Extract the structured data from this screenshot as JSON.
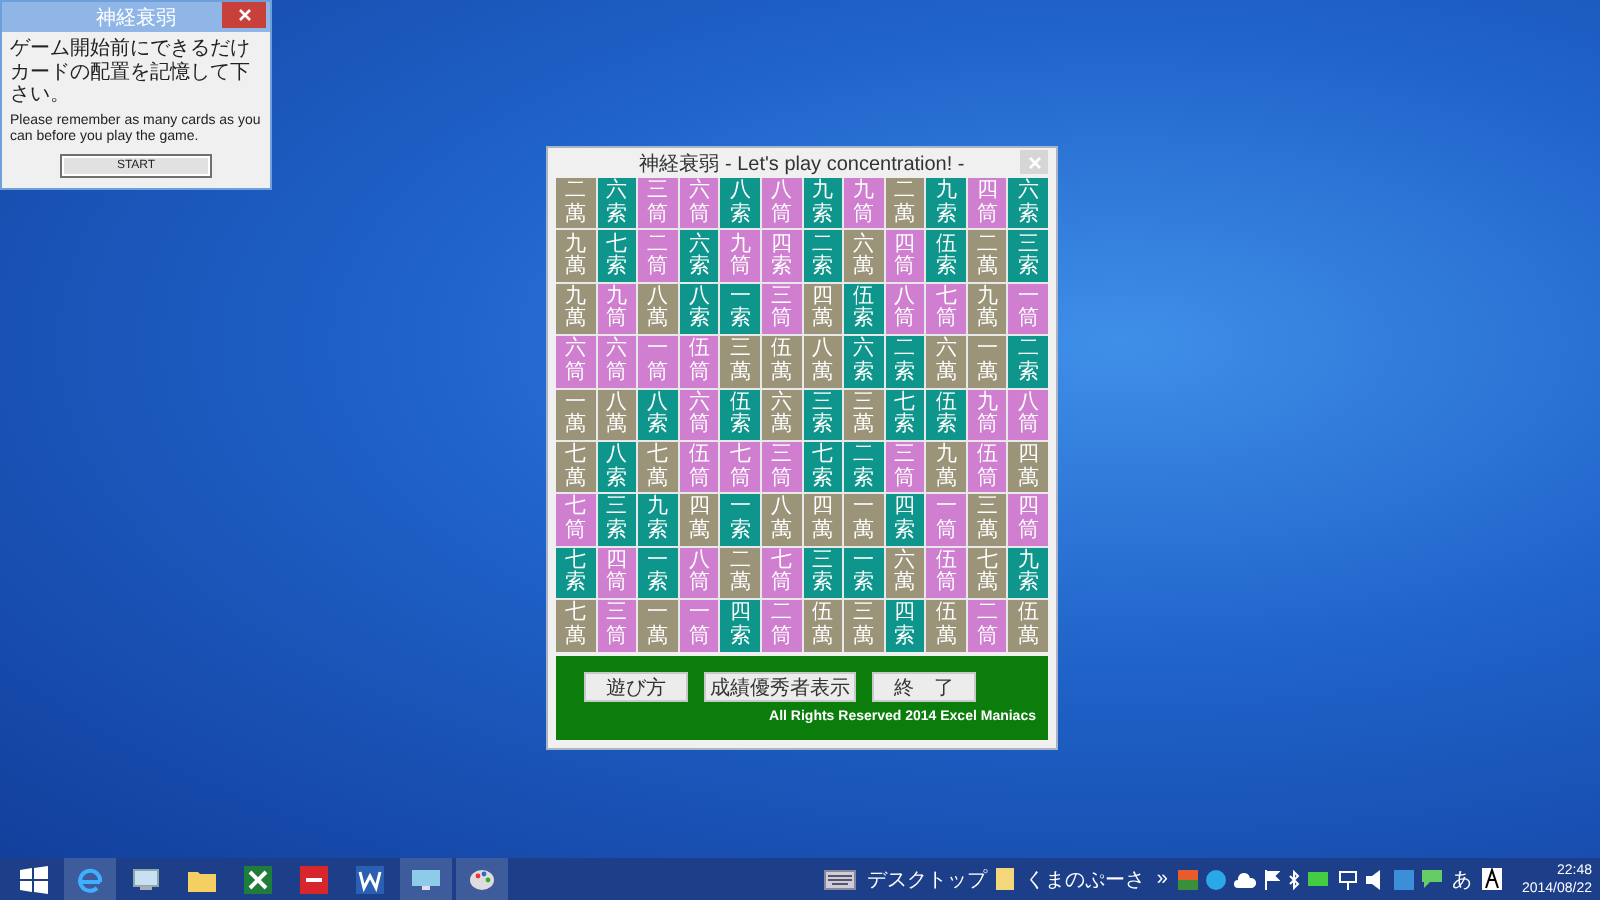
{
  "dialog": {
    "title": "神経衰弱",
    "message_ja": "ゲーム開始前にできるだけカードの配置を記憶して下さい。",
    "message_en": "Please remember as many cards as you can  before you play the game.",
    "button": "START"
  },
  "window": {
    "title": "神経衰弱 - Let's play concentration!  -"
  },
  "board": {
    "rows": [
      [
        {
          "label": "二萬",
          "color": "#9b9478"
        },
        {
          "label": "六索",
          "color": "#0e968c"
        },
        {
          "label": "三筒",
          "color": "#d07fd0"
        },
        {
          "label": "六筒",
          "color": "#d07fd0"
        },
        {
          "label": "八索",
          "color": "#0e968c"
        },
        {
          "label": "八筒",
          "color": "#d07fd0"
        },
        {
          "label": "九索",
          "color": "#0e968c"
        },
        {
          "label": "九筒",
          "color": "#d07fd0"
        },
        {
          "label": "二萬",
          "color": "#9b9478"
        },
        {
          "label": "九索",
          "color": "#0e968c"
        },
        {
          "label": "四筒",
          "color": "#d07fd0"
        },
        {
          "label": "六索",
          "color": "#0e968c"
        }
      ],
      [
        {
          "label": "九萬",
          "color": "#9b9478"
        },
        {
          "label": "七索",
          "color": "#0e968c"
        },
        {
          "label": "二筒",
          "color": "#d07fd0"
        },
        {
          "label": "六索",
          "color": "#0e968c"
        },
        {
          "label": "九筒",
          "color": "#d07fd0"
        },
        {
          "label": "四索",
          "color": "#d07fd0"
        },
        {
          "label": "二索",
          "color": "#0e968c"
        },
        {
          "label": "六萬",
          "color": "#9b9478"
        },
        {
          "label": "四筒",
          "color": "#d07fd0"
        },
        {
          "label": "伍索",
          "color": "#0e968c"
        },
        {
          "label": "二萬",
          "color": "#9b9478"
        },
        {
          "label": "三索",
          "color": "#0e968c"
        }
      ],
      [
        {
          "label": "九萬",
          "color": "#9b9478"
        },
        {
          "label": "九筒",
          "color": "#d07fd0"
        },
        {
          "label": "八萬",
          "color": "#9b9478"
        },
        {
          "label": "八索",
          "color": "#0e968c"
        },
        {
          "label": "一索",
          "color": "#0e968c"
        },
        {
          "label": "三筒",
          "color": "#d07fd0"
        },
        {
          "label": "四萬",
          "color": "#9b9478"
        },
        {
          "label": "伍索",
          "color": "#0e968c"
        },
        {
          "label": "八筒",
          "color": "#d07fd0"
        },
        {
          "label": "七筒",
          "color": "#d07fd0"
        },
        {
          "label": "九萬",
          "color": "#9b9478"
        },
        {
          "label": "一筒",
          "color": "#d07fd0"
        }
      ],
      [
        {
          "label": "六筒",
          "color": "#d07fd0"
        },
        {
          "label": "六筒",
          "color": "#d07fd0"
        },
        {
          "label": "一筒",
          "color": "#d07fd0"
        },
        {
          "label": "伍筒",
          "color": "#d07fd0"
        },
        {
          "label": "三萬",
          "color": "#9b9478"
        },
        {
          "label": "伍萬",
          "color": "#9b9478"
        },
        {
          "label": "八萬",
          "color": "#9b9478"
        },
        {
          "label": "六索",
          "color": "#0e968c"
        },
        {
          "label": "二索",
          "color": "#0e968c"
        },
        {
          "label": "六萬",
          "color": "#9b9478"
        },
        {
          "label": "一萬",
          "color": "#9b9478"
        },
        {
          "label": "二索",
          "color": "#0e968c"
        }
      ],
      [
        {
          "label": "一萬",
          "color": "#9b9478"
        },
        {
          "label": "八萬",
          "color": "#9b9478"
        },
        {
          "label": "八索",
          "color": "#0e968c"
        },
        {
          "label": "六筒",
          "color": "#d07fd0"
        },
        {
          "label": "伍索",
          "color": "#0e968c"
        },
        {
          "label": "六萬",
          "color": "#9b9478"
        },
        {
          "label": "三索",
          "color": "#0e968c"
        },
        {
          "label": "三萬",
          "color": "#9b9478"
        },
        {
          "label": "七索",
          "color": "#0e968c"
        },
        {
          "label": "伍索",
          "color": "#0e968c"
        },
        {
          "label": "九筒",
          "color": "#d07fd0"
        },
        {
          "label": "八筒",
          "color": "#d07fd0"
        }
      ],
      [
        {
          "label": "七萬",
          "color": "#9b9478"
        },
        {
          "label": "八索",
          "color": "#0e968c"
        },
        {
          "label": "七萬",
          "color": "#9b9478"
        },
        {
          "label": "伍筒",
          "color": "#d07fd0"
        },
        {
          "label": "七筒",
          "color": "#d07fd0"
        },
        {
          "label": "三筒",
          "color": "#d07fd0"
        },
        {
          "label": "七索",
          "color": "#0e968c"
        },
        {
          "label": "二索",
          "color": "#0e968c"
        },
        {
          "label": "三筒",
          "color": "#d07fd0"
        },
        {
          "label": "九萬",
          "color": "#9b9478"
        },
        {
          "label": "伍筒",
          "color": "#d07fd0"
        },
        {
          "label": "四萬",
          "color": "#9b9478"
        }
      ],
      [
        {
          "label": "七筒",
          "color": "#d07fd0"
        },
        {
          "label": "三索",
          "color": "#0e968c"
        },
        {
          "label": "九索",
          "color": "#0e968c"
        },
        {
          "label": "四萬",
          "color": "#9b9478"
        },
        {
          "label": "一索",
          "color": "#0e968c"
        },
        {
          "label": "八萬",
          "color": "#9b9478"
        },
        {
          "label": "四萬",
          "color": "#9b9478"
        },
        {
          "label": "一萬",
          "color": "#9b9478"
        },
        {
          "label": "四索",
          "color": "#0e968c"
        },
        {
          "label": "一筒",
          "color": "#d07fd0"
        },
        {
          "label": "三萬",
          "color": "#9b9478"
        },
        {
          "label": "四筒",
          "color": "#d07fd0"
        }
      ],
      [
        {
          "label": "七索",
          "color": "#0e968c"
        },
        {
          "label": "四筒",
          "color": "#d07fd0"
        },
        {
          "label": "一索",
          "color": "#0e968c"
        },
        {
          "label": "八筒",
          "color": "#d07fd0"
        },
        {
          "label": "二萬",
          "color": "#9b9478"
        },
        {
          "label": "七筒",
          "color": "#d07fd0"
        },
        {
          "label": "三索",
          "color": "#0e968c"
        },
        {
          "label": "一索",
          "color": "#0e968c"
        },
        {
          "label": "六萬",
          "color": "#9b9478"
        },
        {
          "label": "伍筒",
          "color": "#d07fd0"
        },
        {
          "label": "七萬",
          "color": "#9b9478"
        },
        {
          "label": "九索",
          "color": "#0e968c"
        }
      ],
      [
        {
          "label": "七萬",
          "color": "#9b9478"
        },
        {
          "label": "三筒",
          "color": "#d07fd0"
        },
        {
          "label": "一萬",
          "color": "#9b9478"
        },
        {
          "label": "一筒",
          "color": "#d07fd0"
        },
        {
          "label": "四索",
          "color": "#0e968c"
        },
        {
          "label": "二筒",
          "color": "#d07fd0"
        },
        {
          "label": "伍萬",
          "color": "#9b9478"
        },
        {
          "label": "三萬",
          "color": "#9b9478"
        },
        {
          "label": "四索",
          "color": "#0e968c"
        },
        {
          "label": "伍萬",
          "color": "#9b9478"
        },
        {
          "label": "二筒",
          "color": "#d07fd0"
        },
        {
          "label": "伍萬",
          "color": "#9b9478"
        }
      ]
    ]
  },
  "buttons": [
    "遊び方",
    "成績優秀者表示",
    "終　了"
  ],
  "copyright": "All Rights Reserved 2014 Excel Maniacs",
  "tray": {
    "desktop_label": "デスクトップ",
    "toolbar_label": "くまのぷーさ",
    "toolbar_more": "»",
    "ime": "あ",
    "time": "22:48",
    "date": "2014/08/22"
  }
}
